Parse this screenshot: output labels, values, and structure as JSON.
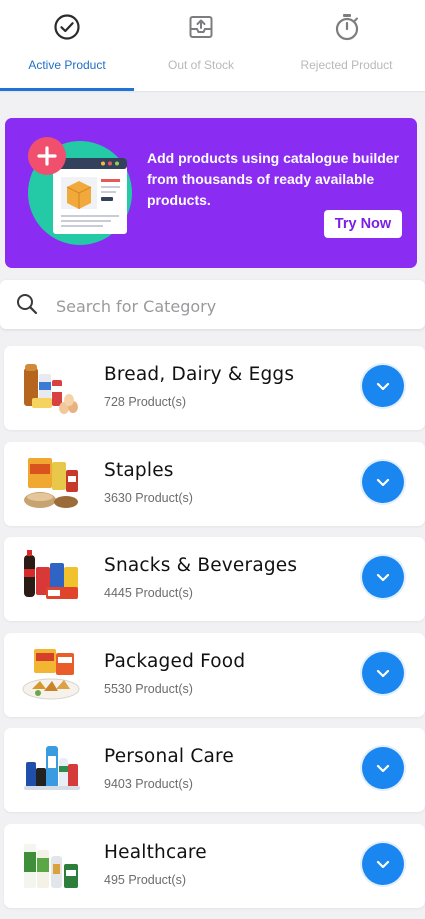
{
  "tabs": [
    {
      "label": "Active Product",
      "icon": "check-circle-icon",
      "active": true
    },
    {
      "label": "Out of Stock",
      "icon": "archive-upload-icon",
      "active": false
    },
    {
      "label": "Rejected Product",
      "icon": "stopwatch-icon",
      "active": false
    }
  ],
  "banner": {
    "text": "Add products using catalogue builder from thousands of ready available products.",
    "button_label": "Try Now",
    "background_color": "#8a2cf2"
  },
  "search": {
    "placeholder": "Search for Category"
  },
  "categories": [
    {
      "name": "Bread, Dairy & Eggs",
      "count": "728 Product(s)",
      "image": "bread-dairy-eggs-image"
    },
    {
      "name": "Staples",
      "count": "3630 Product(s)",
      "image": "staples-image"
    },
    {
      "name": "Snacks & Beverages",
      "count": "4445 Product(s)",
      "image": "snacks-beverages-image"
    },
    {
      "name": "Packaged Food",
      "count": "5530 Product(s)",
      "image": "packaged-food-image"
    },
    {
      "name": "Personal Care",
      "count": "9403 Product(s)",
      "image": "personal-care-image"
    },
    {
      "name": "Healthcare",
      "count": "495 Product(s)",
      "image": "healthcare-image"
    }
  ],
  "colors": {
    "accent": "#1f74d6",
    "expand_button": "#1a86f0",
    "banner": "#8a2cf2"
  }
}
